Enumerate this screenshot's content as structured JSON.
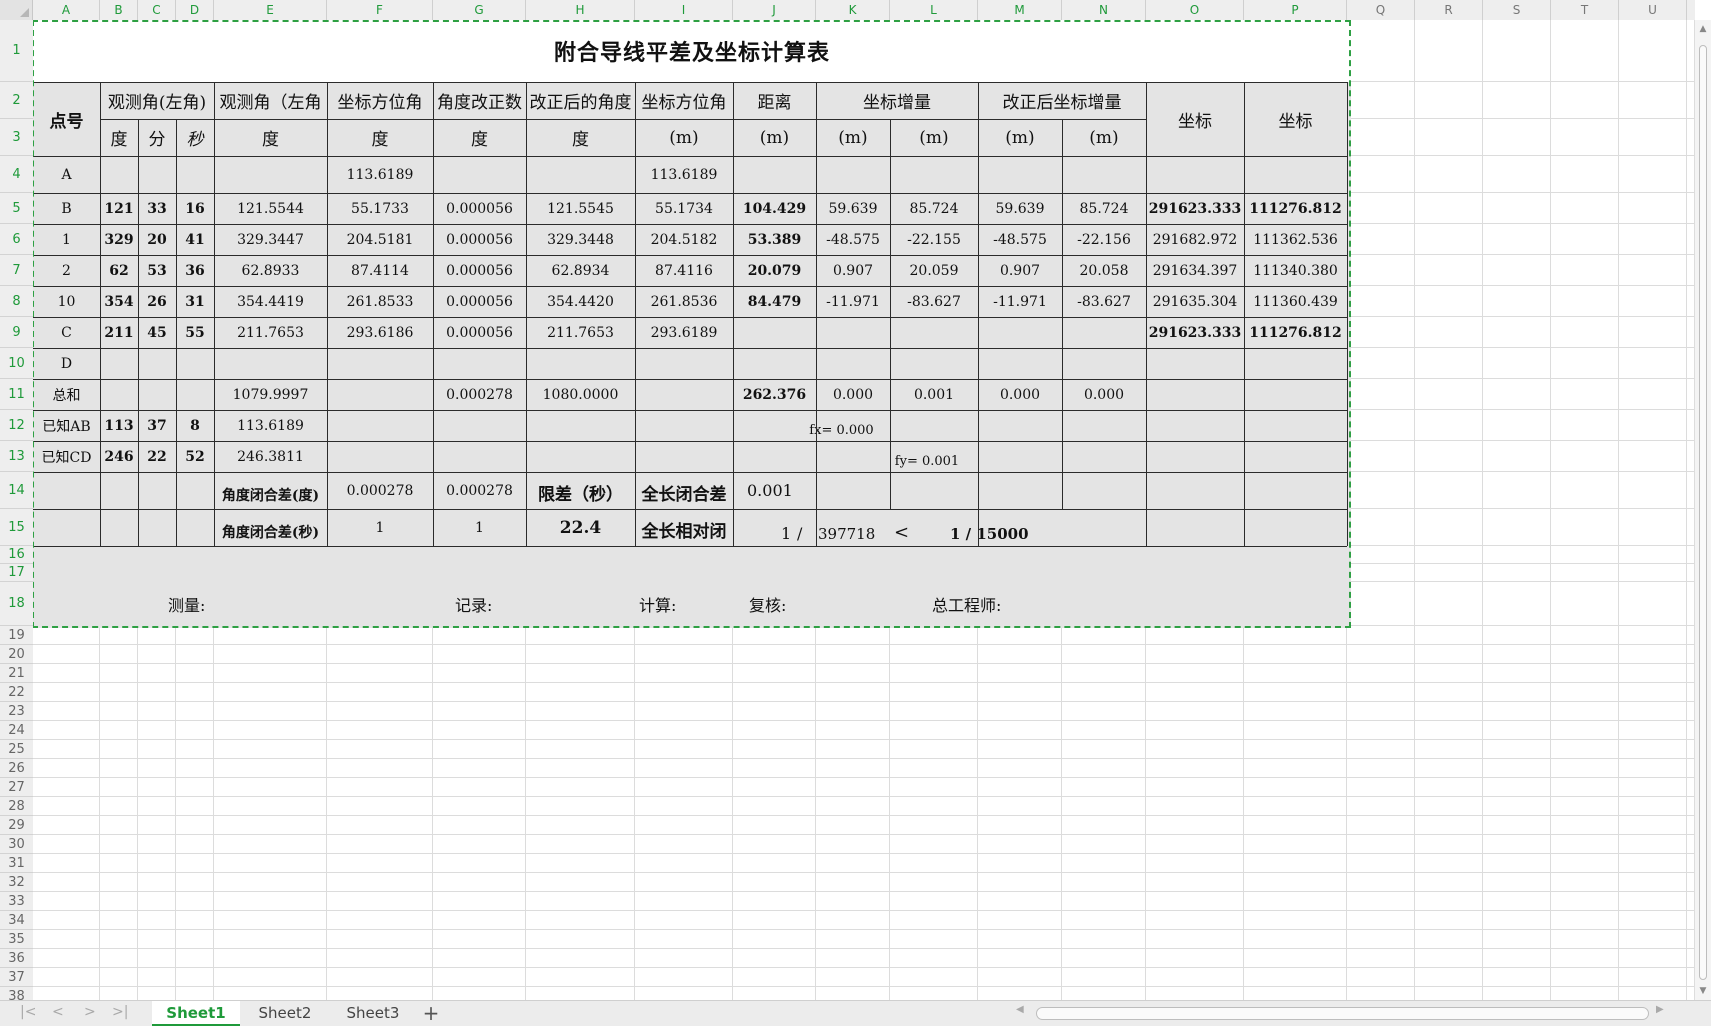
{
  "columns": [
    "A",
    "B",
    "C",
    "D",
    "E",
    "F",
    "G",
    "H",
    "I",
    "J",
    "K",
    "L",
    "M",
    "N",
    "O",
    "P",
    "Q",
    "R",
    "S",
    "T",
    "U"
  ],
  "rows": [
    "1",
    "2",
    "3",
    "4",
    "5",
    "6",
    "7",
    "8",
    "9",
    "10",
    "11",
    "12",
    "13",
    "14",
    "15",
    "16",
    "17",
    "18",
    "19",
    "20",
    "21",
    "22",
    "23",
    "24",
    "25",
    "26",
    "27",
    "28",
    "29",
    "30",
    "31",
    "32",
    "33",
    "34",
    "35",
    "36",
    "37",
    "38"
  ],
  "title": "附合导线平差及坐标计算表",
  "header": {
    "point_no": "点号",
    "obs_angle_dms": "观测角(左角)",
    "obs_angle_deg": "观测角（左角",
    "azimuth": "坐标方位角",
    "angle_corr": "角度改正数",
    "corrected_angle": "改正后的角度",
    "azimuth2": "坐标方位角",
    "distance": "距离",
    "coord_increment": "坐标增量",
    "corrected_increment": "改正后坐标增量",
    "coord_o": "坐标",
    "coord_p": "坐标",
    "unit_deg": "度",
    "unit_min": "分",
    "unit_sec": "秒",
    "unit_E": "度",
    "unit_F": "度",
    "unit_G": "度",
    "unit_H": "度",
    "unit_I": "(m)",
    "unit_J": "(m)",
    "unit_K": "(m)",
    "unit_L": "(m)",
    "unit_M": "(m)",
    "unit_N": "(m)"
  },
  "data_rows": [
    {
      "A": "A",
      "B": "",
      "C": "",
      "D": "",
      "E": "",
      "F": "113.6189",
      "G": "",
      "H": "",
      "I": "113.6189",
      "J": "",
      "K": "",
      "L": "",
      "M": "",
      "N": "",
      "O": "",
      "P": ""
    },
    {
      "A": "B",
      "B": "121",
      "C": "33",
      "D": "16",
      "E": "121.5544",
      "F": "55.1733",
      "G": "0.000056",
      "H": "121.5545",
      "I": "55.1734",
      "J": "104.429",
      "K": "59.639",
      "L": "85.724",
      "M": "59.639",
      "N": "85.724",
      "O": "291623.333",
      "P": "111276.812"
    },
    {
      "A": "1",
      "B": "329",
      "C": "20",
      "D": "41",
      "E": "329.3447",
      "F": "204.5181",
      "G": "0.000056",
      "H": "329.3448",
      "I": "204.5182",
      "J": "53.389",
      "K": "-48.575",
      "L": "-22.155",
      "M": "-48.575",
      "N": "-22.156",
      "O": "291682.972",
      "P": "111362.536"
    },
    {
      "A": "2",
      "B": "62",
      "C": "53",
      "D": "36",
      "E": "62.8933",
      "F": "87.4114",
      "G": "0.000056",
      "H": "62.8934",
      "I": "87.4116",
      "J": "20.079",
      "K": "0.907",
      "L": "20.059",
      "M": "0.907",
      "N": "20.058",
      "O": "291634.397",
      "P": "111340.380"
    },
    {
      "A": "10",
      "B": "354",
      "C": "26",
      "D": "31",
      "E": "354.4419",
      "F": "261.8533",
      "G": "0.000056",
      "H": "354.4420",
      "I": "261.8536",
      "J": "84.479",
      "K": "-11.971",
      "L": "-83.627",
      "M": "-11.971",
      "N": "-83.627",
      "O": "291635.304",
      "P": "111360.439"
    },
    {
      "A": "C",
      "B": "211",
      "C": "45",
      "D": "55",
      "E": "211.7653",
      "F": "293.6186",
      "G": "0.000056",
      "H": "211.7653",
      "I": "293.6189",
      "J": "",
      "K": "",
      "L": "",
      "M": "",
      "N": "",
      "O": "291623.333",
      "P": "111276.812"
    },
    {
      "A": "D",
      "B": "",
      "C": "",
      "D": "",
      "E": "",
      "F": "",
      "G": "",
      "H": "",
      "I": "",
      "J": "",
      "K": "",
      "L": "",
      "M": "",
      "N": "",
      "O": "",
      "P": ""
    },
    {
      "A": "总和",
      "B": "",
      "C": "",
      "D": "",
      "E": "1079.9997",
      "F": "",
      "G": "0.000278",
      "H": "1080.0000",
      "I": "",
      "J": "262.376",
      "K": "0.000",
      "L": "0.001",
      "M": "0.000",
      "N": "0.000",
      "O": "",
      "P": ""
    },
    {
      "A": "已知AB",
      "B": "113",
      "C": "37",
      "D": "8",
      "E": "113.6189",
      "F": "",
      "G": "",
      "H": "",
      "I": "",
      "J": "",
      "K": "",
      "L": "",
      "M": "",
      "N": "",
      "O": "",
      "P": ""
    },
    {
      "A": "已知CD",
      "B": "246",
      "C": "22",
      "D": "52",
      "E": "246.3811",
      "F": "",
      "G": "",
      "H": "",
      "I": "",
      "J": "",
      "K": "",
      "L": "",
      "M": "",
      "N": "",
      "O": "",
      "P": ""
    }
  ],
  "fx_label": "fx= 0.000",
  "fy_label": "fy= 0.001",
  "closure": {
    "angle_deg_label": "角度闭合差(度)",
    "angle_deg_F": "0.000278",
    "angle_deg_G": "0.000278",
    "limit_label": "限差（秒）",
    "total_len_label": "全长闭合差",
    "total_len_value": "0.001",
    "angle_sec_label": "角度闭合差(秒)",
    "angle_sec_F": "1",
    "angle_sec_G": "1",
    "limit_value": "22.4",
    "relative_label": "全长相对闭",
    "relative_num": "1",
    "relative_slash": "/",
    "relative_den": "397718",
    "lt_sign": "<",
    "tolerance": "1 / 15000"
  },
  "footer": {
    "surveyor": "测量:",
    "recorder": "记录:",
    "calculator": "计算:",
    "checker": "复核:",
    "chief_engineer": "总工程师:"
  },
  "tabs": [
    "Sheet1",
    "Sheet2",
    "Sheet3"
  ],
  "active_tab": "Sheet1",
  "add_tab": "+"
}
